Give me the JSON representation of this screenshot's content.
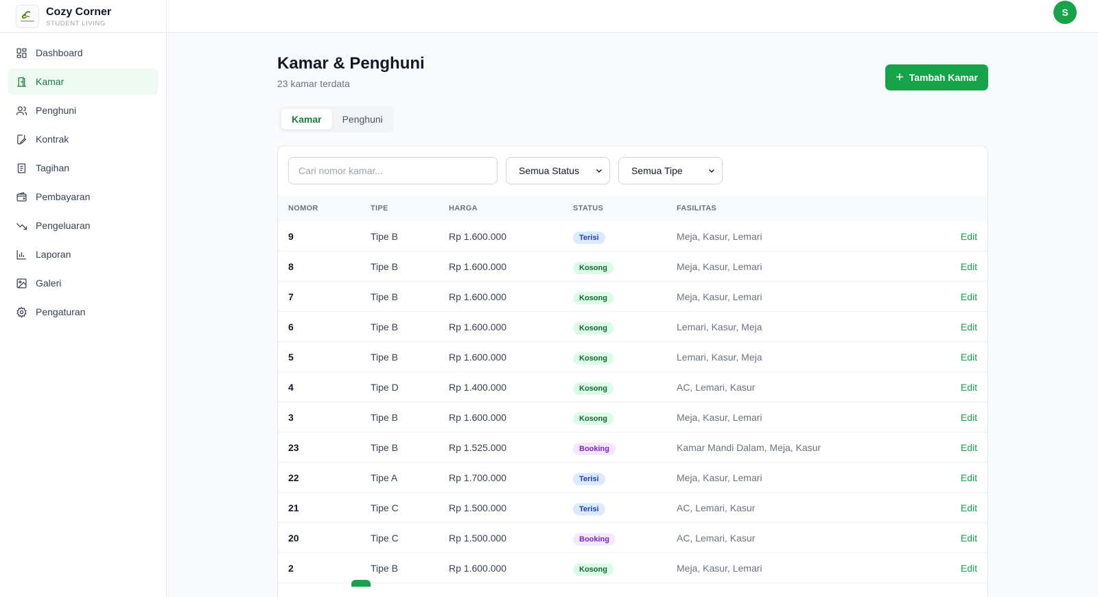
{
  "brand": {
    "name": "Cozy Corner",
    "subtitle": "STUDENT LIVING"
  },
  "user": {
    "avatar_letter": "S"
  },
  "sidebar": {
    "items": [
      {
        "label": "Dashboard",
        "icon": "dashboard-icon",
        "active": false
      },
      {
        "label": "Kamar",
        "icon": "door-icon",
        "active": true
      },
      {
        "label": "Penghuni",
        "icon": "users-icon",
        "active": false
      },
      {
        "label": "Kontrak",
        "icon": "edit-document-icon",
        "active": false
      },
      {
        "label": "Tagihan",
        "icon": "receipt-icon",
        "active": false
      },
      {
        "label": "Pembayaran",
        "icon": "wallet-icon",
        "active": false
      },
      {
        "label": "Pengeluaran",
        "icon": "trend-down-icon",
        "active": false
      },
      {
        "label": "Laporan",
        "icon": "bar-chart-icon",
        "active": false
      },
      {
        "label": "Galeri",
        "icon": "image-icon",
        "active": false
      },
      {
        "label": "Pengaturan",
        "icon": "gear-icon",
        "active": false
      }
    ]
  },
  "page": {
    "title": "Kamar & Penghuni",
    "subtitle": "23 kamar terdata",
    "add_button": "Tambah Kamar"
  },
  "tabs": [
    {
      "label": "Kamar",
      "active": true
    },
    {
      "label": "Penghuni",
      "active": false
    }
  ],
  "filters": {
    "search_placeholder": "Cari nomor kamar...",
    "status_select": "Semua Status",
    "type_select": "Semua Tipe"
  },
  "table": {
    "headers": {
      "nomor": "NOMOR",
      "tipe": "TIPE",
      "harga": "HARGA",
      "status": "STATUS",
      "fasilitas": "FASILITAS"
    },
    "edit_label": "Edit",
    "rows": [
      {
        "nomor": "9",
        "tipe": "Tipe B",
        "harga": "Rp 1.600.000",
        "status": "Terisi",
        "fasilitas": "Meja, Kasur, Lemari"
      },
      {
        "nomor": "8",
        "tipe": "Tipe B",
        "harga": "Rp 1.600.000",
        "status": "Kosong",
        "fasilitas": "Meja, Kasur, Lemari"
      },
      {
        "nomor": "7",
        "tipe": "Tipe B",
        "harga": "Rp 1.600.000",
        "status": "Kosong",
        "fasilitas": "Meja, Kasur, Lemari"
      },
      {
        "nomor": "6",
        "tipe": "Tipe B",
        "harga": "Rp 1.600.000",
        "status": "Kosong",
        "fasilitas": "Lemari, Kasur, Meja"
      },
      {
        "nomor": "5",
        "tipe": "Tipe B",
        "harga": "Rp 1.600.000",
        "status": "Kosong",
        "fasilitas": "Lemari, Kasur, Meja"
      },
      {
        "nomor": "4",
        "tipe": "Tipe D",
        "harga": "Rp 1.400.000",
        "status": "Kosong",
        "fasilitas": "AC, Lemari, Kasur"
      },
      {
        "nomor": "3",
        "tipe": "Tipe B",
        "harga": "Rp 1.600.000",
        "status": "Kosong",
        "fasilitas": "Meja, Kasur, Lemari"
      },
      {
        "nomor": "23",
        "tipe": "Tipe B",
        "harga": "Rp 1.525.000",
        "status": "Booking",
        "fasilitas": "Kamar Mandi Dalam, Meja, Kasur"
      },
      {
        "nomor": "22",
        "tipe": "Tipe A",
        "harga": "Rp 1.700.000",
        "status": "Terisi",
        "fasilitas": "Meja, Kasur, Lemari"
      },
      {
        "nomor": "21",
        "tipe": "Tipe C",
        "harga": "Rp 1.500.000",
        "status": "Terisi",
        "fasilitas": "AC, Lemari, Kasur"
      },
      {
        "nomor": "20",
        "tipe": "Tipe C",
        "harga": "Rp 1.500.000",
        "status": "Booking",
        "fasilitas": "AC, Lemari, Kasur"
      },
      {
        "nomor": "2",
        "tipe": "Tipe B",
        "harga": "Rp 1.600.000",
        "status": "Kosong",
        "fasilitas": "Meja, Kasur, Lemari"
      }
    ]
  },
  "colors": {
    "accent": "#16a34a",
    "terisi": "#1e40af",
    "kosong": "#166534",
    "booking": "#7e22ce"
  }
}
